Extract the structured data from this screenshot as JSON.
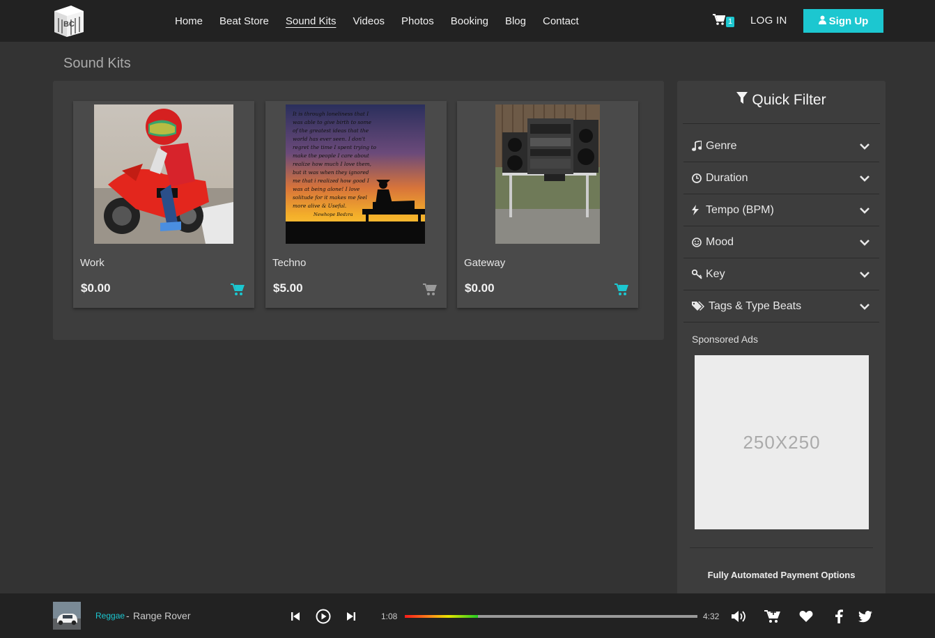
{
  "logo": {
    "text": "BC"
  },
  "nav": {
    "items": [
      {
        "label": "Home",
        "active": false
      },
      {
        "label": "Beat Store",
        "active": false
      },
      {
        "label": "Sound Kits",
        "active": true
      },
      {
        "label": "Videos",
        "active": false
      },
      {
        "label": "Photos",
        "active": false
      },
      {
        "label": "Booking",
        "active": false
      },
      {
        "label": "Blog",
        "active": false
      },
      {
        "label": "Contact",
        "active": false
      }
    ],
    "cart_count": "1",
    "login_label": "LOG IN",
    "signup_label": "Sign Up"
  },
  "page": {
    "title": "Sound Kits"
  },
  "products": [
    {
      "name": "Work",
      "price": "$0.00",
      "cart_color": "#1cc7d0",
      "image": "kid-on-red-motorbike"
    },
    {
      "name": "Techno",
      "price": "$5.00",
      "cart_color": "#9a9a9a",
      "image": "quote-silhouette-sunset",
      "quote_lines": [
        "It is through loneliness that I",
        "was able to give birth to some",
        "of the greatest ideas that the",
        "world has ever seen. I don't",
        "regret the time I spent trying to",
        "make the people I care about",
        "realize how much I love them,",
        "but it was when they ignored",
        "me that i realized how good I",
        "was at being alone! I love",
        "solitude for it makes me feel",
        "more alive & Useful."
      ],
      "quote_author": "Newhope Bedzra"
    },
    {
      "name": "Gateway",
      "price": "$0.00",
      "cart_color": "#1cc7d0",
      "image": "stereo-system-on-table"
    }
  ],
  "sidebar": {
    "title": "Quick Filter",
    "filters": [
      {
        "label": "Genre",
        "icon": "music-note-icon"
      },
      {
        "label": "Duration",
        "icon": "clock-icon"
      },
      {
        "label": "Tempo (BPM)",
        "icon": "bolt-icon"
      },
      {
        "label": "Mood",
        "icon": "smile-icon"
      },
      {
        "label": "Key",
        "icon": "key-icon"
      },
      {
        "label": "Tags & Type Beats",
        "icon": "tags-icon"
      }
    ],
    "sponsored_label": "Sponsored Ads",
    "ad_text": "250X250",
    "payment_label": "Fully Automated Payment Options"
  },
  "player": {
    "genre": "Reggae",
    "separator": "-",
    "track": "Range Rover",
    "current_time": "1:08",
    "total_time": "4:32",
    "progress_fraction": 0.25
  },
  "colors": {
    "accent": "#1cc7d0",
    "background": "#333333",
    "panel": "#3d3d3d",
    "card": "#4a4a4a",
    "bar": "#222222"
  }
}
